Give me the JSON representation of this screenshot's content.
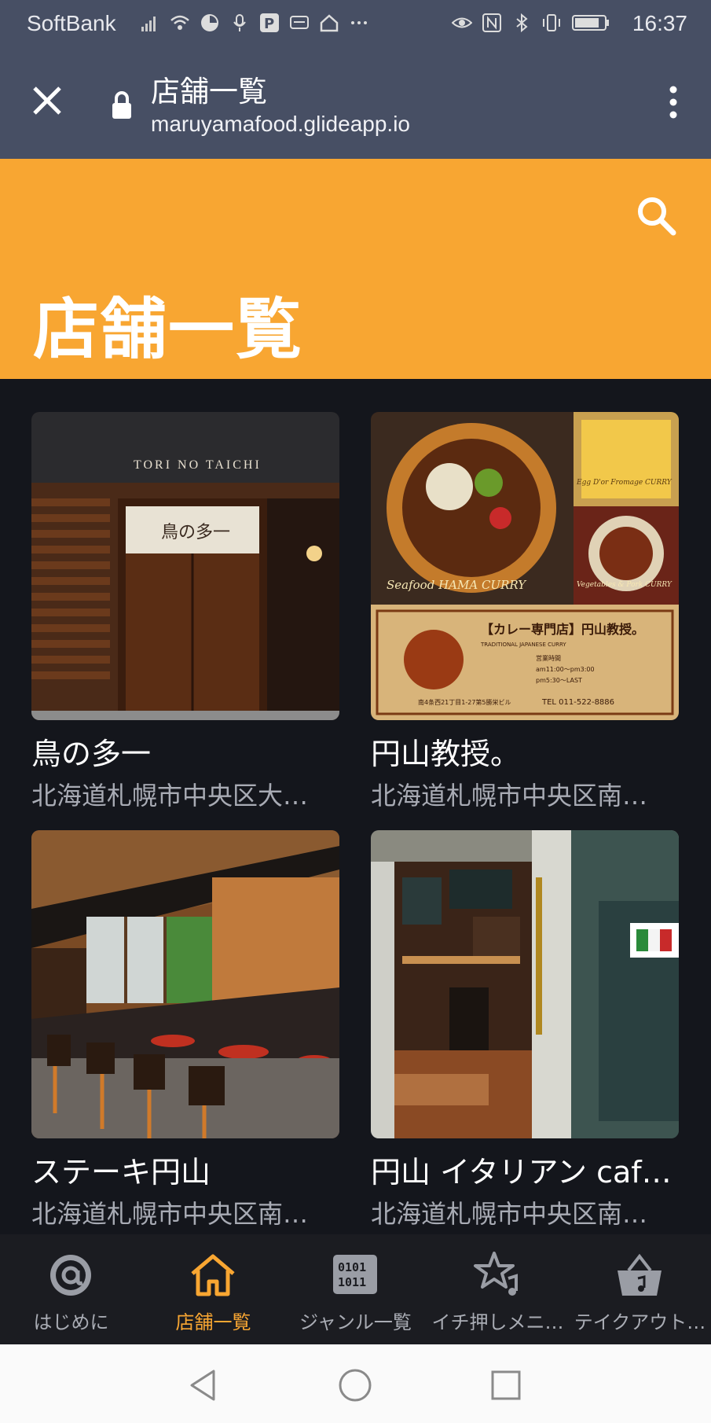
{
  "status_bar": {
    "carrier": "SoftBank",
    "time": "16:37",
    "left_icons": [
      "signal-icon",
      "wifi-icon",
      "data-saver-icon",
      "mic-icon",
      "paypay-icon",
      "message-icon",
      "home-icon",
      "more-icon"
    ],
    "right_icons": [
      "eye-icon",
      "nfc-icon",
      "bluetooth-icon",
      "vibrate-icon",
      "battery-icon"
    ]
  },
  "browser": {
    "title": "店舗一覧",
    "url": "maruyamafood.glideapp.io"
  },
  "header": {
    "title": "店舗一覧",
    "bg_color": "#f8a632"
  },
  "stores": [
    {
      "name": "鳥の多一",
      "address": "北海道札幌市中央区大…",
      "image_label": "TORI NO TAICHI"
    },
    {
      "name": "円山教授。",
      "address": "北海道札幌市中央区南…",
      "image_labels": [
        "Seafood HAMA CURRY",
        "Egg D'or Fromage CURRY",
        "Vegetables & Pork CURRY",
        "【カレー専門店】円山教授。",
        "TRADITIONAL JAPANESE CURRY",
        "営業時間",
        "am11:00～pm3:00",
        "pm5:30～LAST",
        "南4条西21丁目1-27第5勝栄ビル",
        "TEL 011-522-8886"
      ]
    },
    {
      "name": "ステーキ円山",
      "address": "北海道札幌市中央区南…"
    },
    {
      "name": "円山 イタリアン caf…",
      "address": "北海道札幌市中央区南…"
    }
  ],
  "tabs": [
    {
      "label": "はじめに",
      "icon": "at-icon",
      "active": false
    },
    {
      "label": "店舗一覧",
      "icon": "home-icon",
      "active": true
    },
    {
      "label": "ジャンル一覧",
      "icon": "binary-icon",
      "active": false
    },
    {
      "label": "イチ押しメニ…",
      "icon": "star-music-icon",
      "active": false
    },
    {
      "label": "テイクアウト…",
      "icon": "basket-icon",
      "active": false
    }
  ],
  "nav": [
    "back-icon",
    "home-circle-icon",
    "recents-icon"
  ]
}
